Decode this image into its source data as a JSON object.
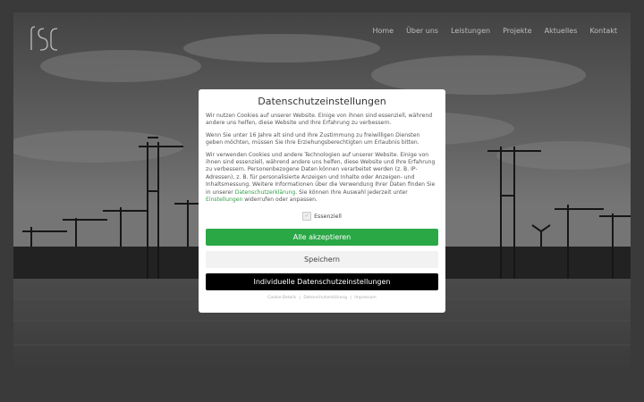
{
  "site": {
    "logo_text": "rsci",
    "nav": [
      "Home",
      "Über uns",
      "Leistungen",
      "Projekte",
      "Aktuelles",
      "Kontakt"
    ]
  },
  "consent": {
    "title": "Datenschutzeinstellungen",
    "p1": "Wir nutzen Cookies auf unserer Website. Einige von ihnen sind essenziell, während andere uns helfen, diese Website und Ihre Erfahrung zu verbessern.",
    "p2": "Wenn Sie unter 16 Jahre alt sind und Ihre Zustimmung zu freiwilligen Diensten geben möchten, müssen Sie Ihre Erziehungsberechtigten um Erlaubnis bitten.",
    "p3_a": "Wir verwenden Cookies und andere Technologien auf unserer Website. Einige von ihnen sind essenziell, während andere uns helfen, diese Website und Ihre Erfahrung zu verbessern. Personenbezogene Daten können verarbeitet werden (z. B. IP-Adressen), z. B. für personalisierte Anzeigen und Inhalte oder Anzeigen- und Inhaltsmessung. Weitere Informationen über die Verwendung Ihrer Daten finden Sie in unserer",
    "p3_link1": "Datenschutzerklärung",
    "p3_b": ". Sie können Ihre Auswahl jederzeit unter",
    "p3_link2": "Einstellungen",
    "p3_c": "widerrufen oder anpassen.",
    "essential_label": "Essenziell",
    "essential_checked": true,
    "accept_all": "Alle akzeptieren",
    "save": "Speichern",
    "individual": "Individuelle Datenschutzeinstellungen",
    "footer": {
      "cookie_details": "Cookie-Details",
      "privacy": "Datenschutzerklärung",
      "imprint": "Impressum",
      "separator": "|"
    }
  },
  "colors": {
    "accept": "#29a845",
    "link": "#2e9e43",
    "individual": "#000000"
  }
}
